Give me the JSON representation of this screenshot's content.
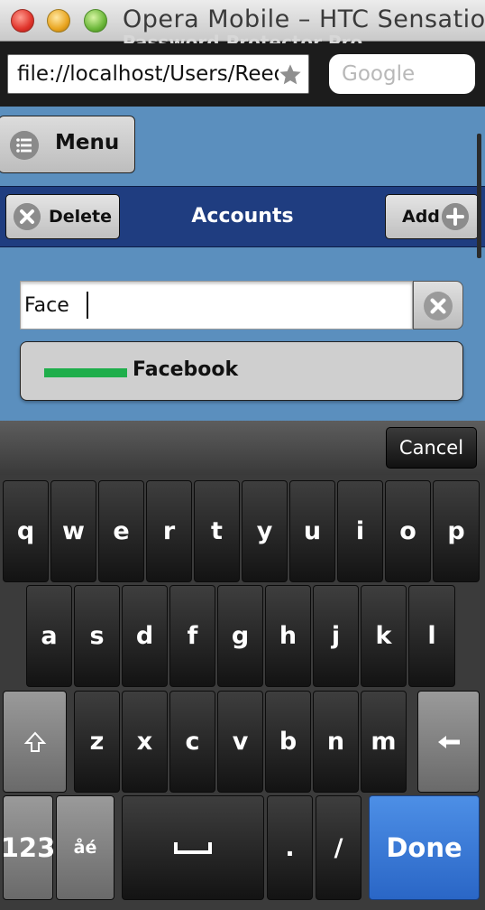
{
  "window": {
    "title": "Opera Mobile – HTC Sensation"
  },
  "browser": {
    "page_title": "Password Protector Pro",
    "url": "file://localhost/Users/Reed",
    "search_placeholder": "Google"
  },
  "app": {
    "menu_label": "Menu",
    "header_title": "Accounts",
    "delete_label": "Delete",
    "add_label": "Add",
    "filter_value": "Face",
    "results": [
      {
        "label": "Facebook",
        "strength_color": "#1fae4b"
      }
    ]
  },
  "keyboard": {
    "cancel_label": "Cancel",
    "row1": [
      "q",
      "w",
      "e",
      "r",
      "t",
      "y",
      "u",
      "i",
      "o",
      "p"
    ],
    "row2": [
      "a",
      "s",
      "d",
      "f",
      "g",
      "h",
      "j",
      "k",
      "l"
    ],
    "row3": [
      "z",
      "x",
      "c",
      "v",
      "b",
      "n",
      "m"
    ],
    "numbers_label": "123",
    "accents_label": "åé",
    "period_label": ".",
    "slash_label": "/",
    "done_label": "Done"
  }
}
